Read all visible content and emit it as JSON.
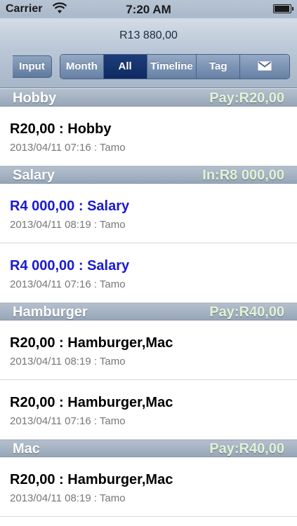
{
  "status_bar": {
    "carrier": "Carrier",
    "time": "7:20 AM",
    "icons": [
      "wifi-icon",
      "battery-icon"
    ],
    "battery_level": 0.95
  },
  "navbar": {
    "total": "R13 880,00",
    "back_label": "Input",
    "segments": [
      {
        "label": "Month",
        "active": false
      },
      {
        "label": "All",
        "active": true
      },
      {
        "label": "Timeline",
        "active": false
      },
      {
        "label": "Tag",
        "active": false
      },
      {
        "icon": "mail-icon",
        "active": false
      }
    ]
  },
  "colors": {
    "active_segment": "#0f2a61",
    "income_text": "#1a1ad0",
    "header_amount": "#e3f3d6"
  },
  "sections": [
    {
      "name": "Hobby",
      "amount": "Pay:R20,00",
      "entries": [
        {
          "title": "R20,00 : Hobby",
          "detail": "2013/04/11 07:16 : Tamo",
          "type": "pay"
        }
      ]
    },
    {
      "name": "Salary",
      "amount": "In:R8 000,00",
      "entries": [
        {
          "title": "R4 000,00 : Salary",
          "detail": "2013/04/11 08:19 : Tamo",
          "type": "income"
        },
        {
          "title": "R4 000,00 : Salary",
          "detail": "2013/04/11 07:16 : Tamo",
          "type": "income"
        }
      ]
    },
    {
      "name": "Hamburger",
      "amount": "Pay:R40,00",
      "entries": [
        {
          "title": "R20,00 : Hamburger,Mac",
          "detail": "2013/04/11 08:19 : Tamo",
          "type": "pay"
        },
        {
          "title": "R20,00 : Hamburger,Mac",
          "detail": "2013/04/11 07:16 : Tamo",
          "type": "pay"
        }
      ]
    },
    {
      "name": "Mac",
      "amount": "Pay:R40,00",
      "entries": [
        {
          "title": "R20,00 : Hamburger,Mac",
          "detail": "2013/04/11 08:19 : Tamo",
          "type": "pay"
        }
      ]
    }
  ]
}
